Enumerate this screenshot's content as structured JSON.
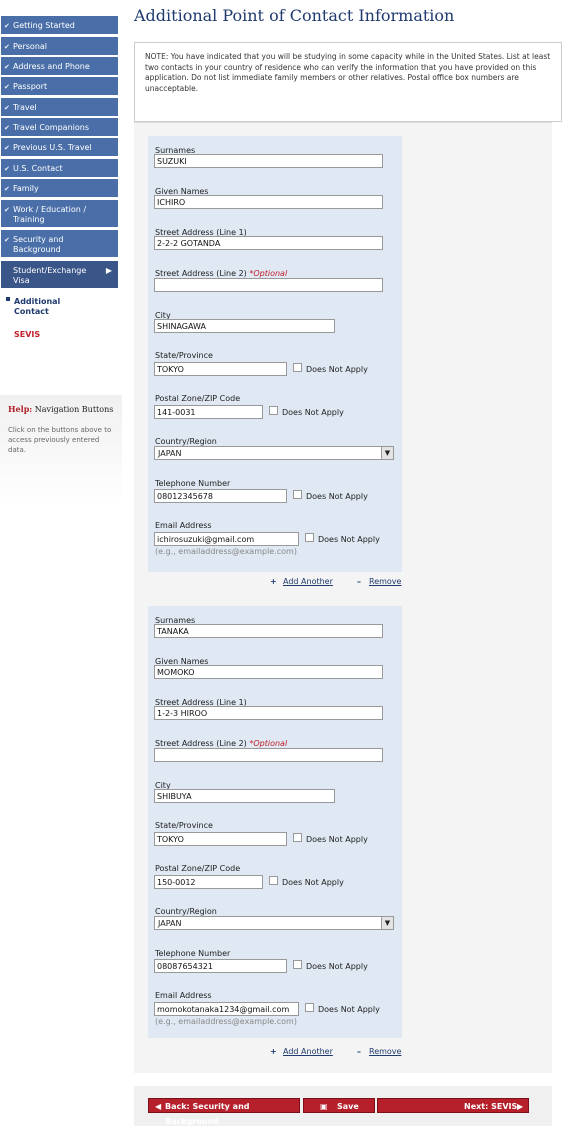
{
  "nav": {
    "items": [
      {
        "label": "Getting Started",
        "lines": [
          "Getting Started"
        ]
      },
      {
        "label": "Personal",
        "lines": [
          "Personal"
        ]
      },
      {
        "label": "Address and Phone",
        "lines": [
          "Address and Phone"
        ]
      },
      {
        "label": "Passport",
        "lines": [
          "Passport"
        ]
      },
      {
        "label": "Travel",
        "lines": [
          "Travel"
        ]
      },
      {
        "label": "Travel Companions",
        "lines": [
          "Travel Companions"
        ]
      },
      {
        "label": "Previous U.S. Travel",
        "lines": [
          "Previous U.S. Travel"
        ]
      },
      {
        "label": "U.S. Contact",
        "lines": [
          "U.S. Contact"
        ]
      },
      {
        "label": "Family",
        "lines": [
          "Family"
        ]
      },
      {
        "label": "Work / Education / Training",
        "lines": [
          "Work / Education /",
          "Training"
        ]
      },
      {
        "label": "Security and Background",
        "lines": [
          "Security and",
          "Background"
        ]
      },
      {
        "label": "Student/Exchange Visa",
        "lines": [
          "Student/Exchange",
          "Visa"
        ]
      }
    ],
    "sub_items": [
      {
        "label_line1": "Additional",
        "label_line2": "Contact"
      },
      {
        "label_line1": "SEVIS",
        "label_line2": ""
      }
    ]
  },
  "help": {
    "title_prefix": "Help:",
    "title_rest": "Navigation Buttons",
    "text": "Click on the buttons above to access previously entered data."
  },
  "page": {
    "title": "Additional Point of Contact Information",
    "note": "NOTE: You have indicated that you will be studying in some capacity while in the United States. List at least two contacts in your country of residence who can verify the information that you have provided on this application. Do not list immediate family members or other relatives. Postal office box numbers are unacceptable."
  },
  "labels": {
    "surnames": "Surnames",
    "given_names": "Given Names",
    "street1": "Street Address (Line 1)",
    "street2": "Street Address (Line 2)",
    "optional": "*Optional",
    "city": "City",
    "state": "State/Province",
    "postal": "Postal Zone/ZIP Code",
    "country": "Country/Region",
    "phone": "Telephone Number",
    "email": "Email Address",
    "does_not_apply": "Does Not Apply",
    "email_hint": "(e.g., emailaddress@example.com)",
    "add_another": "Add Another",
    "remove": "Remove"
  },
  "contacts": [
    {
      "surnames": "SUZUKI",
      "given_names": "ICHIRO",
      "street1": "2-2-2 GOTANDA",
      "street2": "",
      "city": "SHINAGAWA",
      "state": "TOKYO",
      "postal": "141-0031",
      "country": "JAPAN",
      "phone": "08012345678",
      "email": "ichirosuzuki@gmail.com"
    },
    {
      "surnames": "TANAKA",
      "given_names": "MOMOKO",
      "street1": "1-2-3 HIROO",
      "street2": "",
      "city": "SHIBUYA",
      "state": "TOKYO",
      "postal": "150-0012",
      "country": "JAPAN",
      "phone": "08087654321",
      "email": "momokotanaka1234@gmail.com"
    }
  ],
  "buttons": {
    "back": "Back: Security and Background",
    "save": "Save",
    "next": "Next: SEVIS"
  },
  "colors": {
    "nav_bg": "#4a6fa8",
    "accent_red": "#b5202b",
    "title_blue": "#1f3a6e"
  }
}
